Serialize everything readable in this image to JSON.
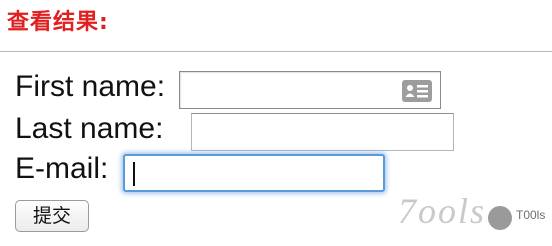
{
  "header": {
    "title": "查看结果:"
  },
  "form": {
    "first_name_label": "First name:",
    "last_name_label": "Last name:",
    "email_label": "E-mail:",
    "first_name_value": "",
    "last_name_value": "",
    "email_value": "",
    "submit_label": "提交"
  },
  "icons": {
    "autofill": "contact-card-icon"
  },
  "watermark": {
    "logo_text": "7ools",
    "label": "T00ls"
  },
  "colors": {
    "title": "#e02020",
    "focus_ring": "#5b9bd8"
  }
}
